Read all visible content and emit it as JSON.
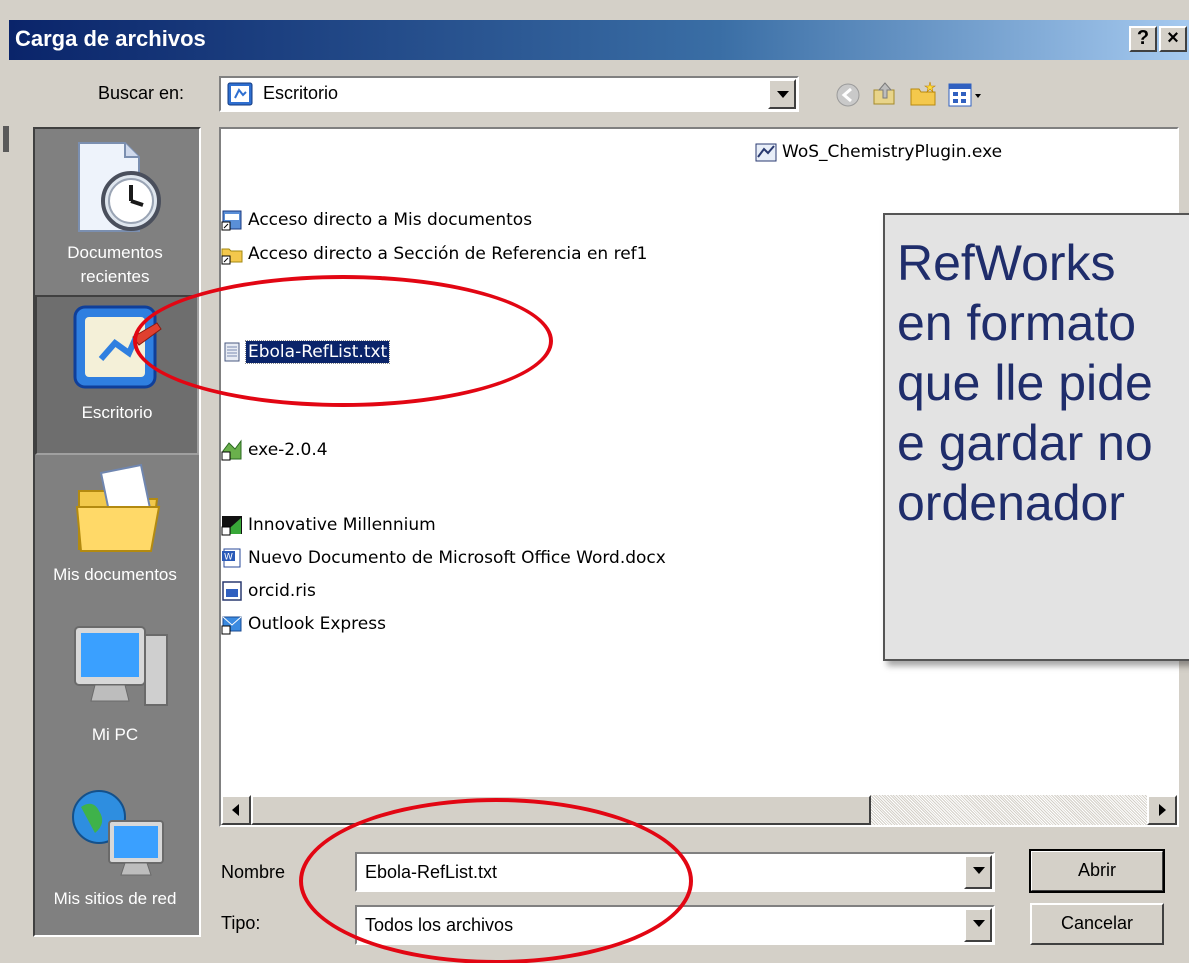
{
  "window": {
    "title": "Carga de archivos",
    "help_btn": "?",
    "close_btn": "×"
  },
  "lookin": {
    "label": "Buscar en:",
    "value": "Escritorio"
  },
  "toolbar": {
    "icons": [
      "back-icon",
      "up-folder-icon",
      "new-folder-icon",
      "view-menu-icon"
    ]
  },
  "places": [
    {
      "label": "Documentos recientes",
      "icon": "recent-documents-icon"
    },
    {
      "label": "Escritorio",
      "icon": "desktop-icon",
      "active": true
    },
    {
      "label": "Mis documentos",
      "icon": "my-documents-icon"
    },
    {
      "label": "Mi PC",
      "icon": "my-computer-icon"
    },
    {
      "label": "Mis sitios de red",
      "icon": "network-places-icon"
    }
  ],
  "files": [
    {
      "name": "WoS_ChemistryPlugin.exe",
      "icon": "installer-icon"
    },
    {
      "name": "Acceso directo a Mis documentos",
      "icon": "shortcut-icon"
    },
    {
      "name": "Acceso directo a Sección de Referencia en ref1",
      "icon": "network-folder-icon"
    },
    {
      "name": "Ebola-RefList.txt",
      "icon": "text-file-icon",
      "selected": true
    },
    {
      "name": "exe-2.0.4",
      "icon": "app-shortcut-icon"
    },
    {
      "name": "Innovative Millennium",
      "icon": "app-shortcut-icon"
    },
    {
      "name": "Nuevo Documento de Microsoft Office Word.docx",
      "icon": "word-doc-icon"
    },
    {
      "name": "orcid.ris",
      "icon": "ris-file-icon"
    },
    {
      "name": "Outlook Express",
      "icon": "outlook-icon"
    }
  ],
  "filename": {
    "label": "Nombre",
    "value": "Ebola-RefList.txt"
  },
  "filetype": {
    "label": "Tipo:",
    "value": "Todos los archivos"
  },
  "buttons": {
    "open": "Abrir",
    "cancel": "Cancelar"
  },
  "callout": {
    "text": "RefWorks\nen formato\nque lle pide\ne gardar no\nordenador"
  },
  "colors": {
    "title_bar": "#0a246a",
    "selection": "#0a246a",
    "highlight_ring": "#e20613",
    "callout_text": "#1f2d6b"
  }
}
